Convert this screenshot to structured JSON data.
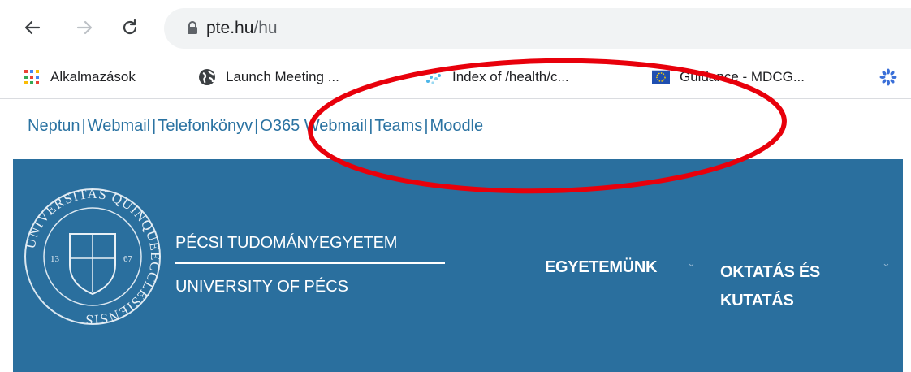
{
  "browser": {
    "url_domain": "pte.hu",
    "url_path": "/hu"
  },
  "bookmarks": [
    {
      "label": "Alkalmazások",
      "icon": "apps-grid-icon"
    },
    {
      "label": "Launch Meeting ...",
      "icon": "globe-icon"
    },
    {
      "label": "Index of /health/c...",
      "icon": "dots-favicon-icon"
    },
    {
      "label": "Guidance - MDCG...",
      "icon": "eu-flag-icon"
    }
  ],
  "quick_links": [
    "Neptun",
    "Webmail",
    "Telefonkönyv",
    "O365 Webmail",
    "Teams",
    "Moodle"
  ],
  "quick_link_separator": "|",
  "site": {
    "seal_text": "UNIVERSITAS QUINQUEECCLESIENSIS",
    "seal_year_left": "13",
    "seal_year_right": "67",
    "name_hu": "PÉCSI TUDOMÁNYEGYETEM",
    "name_en": "UNIVERSITY OF PÉCS",
    "menu": [
      "EGYETEMÜNK",
      "OKTATÁS ÉS",
      "KUTATÁS"
    ]
  },
  "colors": {
    "header_bg": "#2a6f9e",
    "link": "#2b73a2",
    "annotation": "#e8000b"
  }
}
